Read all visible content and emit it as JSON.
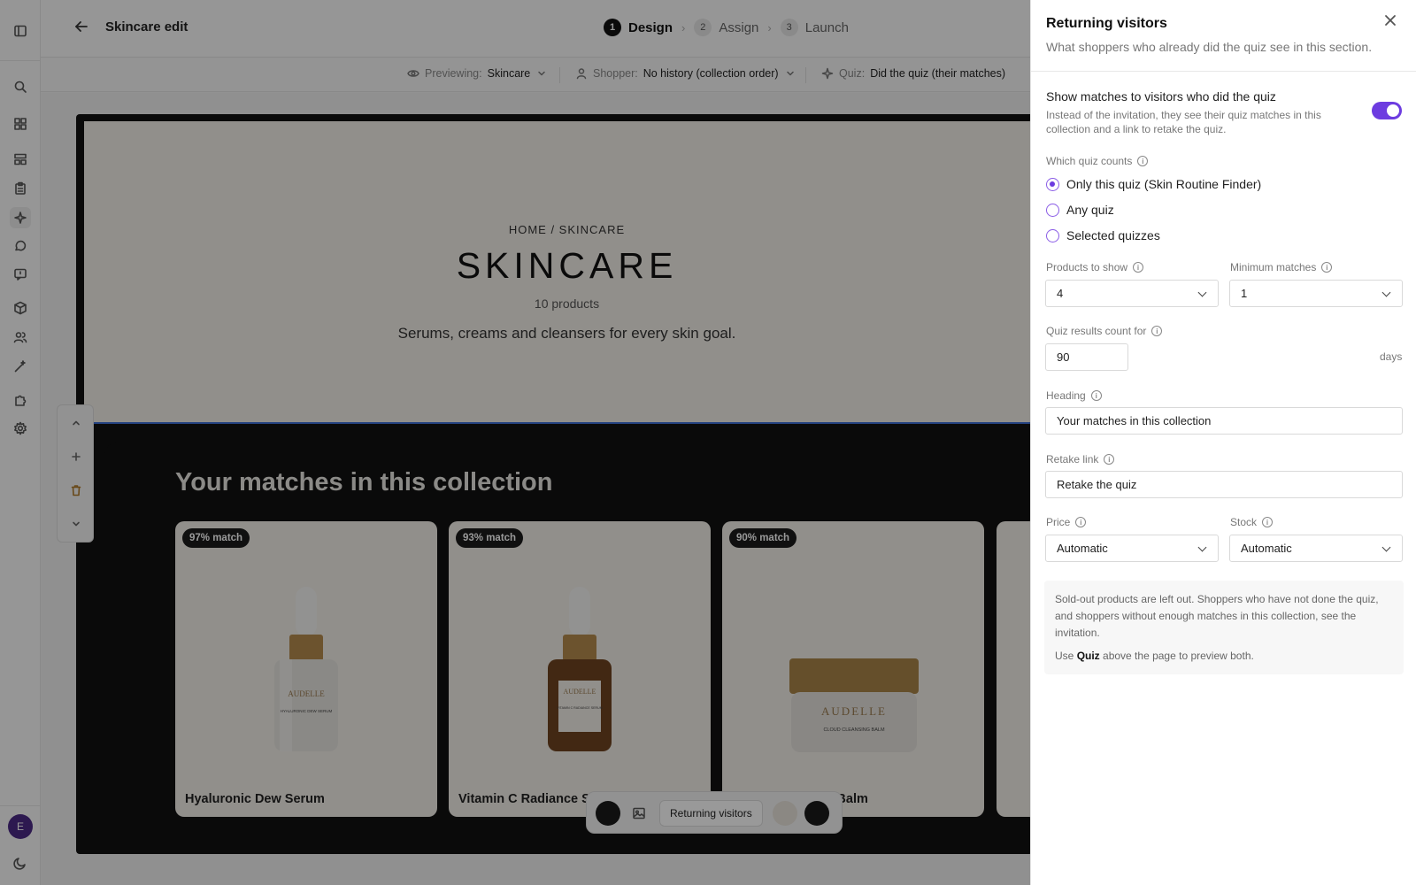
{
  "header": {
    "title": "Skincare edit",
    "steps": [
      {
        "num": "1",
        "label": "Design"
      },
      {
        "num": "2",
        "label": "Assign"
      },
      {
        "num": "3",
        "label": "Launch"
      }
    ]
  },
  "preview_bar": {
    "previewing_label": "Previewing:",
    "previewing_value": "Skincare",
    "shopper_label": "Shopper:",
    "shopper_value": "No history (collection order)",
    "quiz_label": "Quiz:",
    "quiz_value": "Did the quiz (their matches)"
  },
  "hero": {
    "breadcrumb": "HOME  /  SKINCARE",
    "title": "SKINCARE",
    "count": "10 products",
    "description": "Serums, creams and cleansers for every skin goal."
  },
  "matches": {
    "heading": "Your matches in this collection",
    "cards": [
      {
        "badge": "97% match",
        "name": "Hyaluronic Dew Serum",
        "brand": "AUDELLE",
        "label": "HYALURONIC DEW SERUM"
      },
      {
        "badge": "93% match",
        "name": "Vitamin C Radiance Ser",
        "brand": "AUDELLE",
        "label": "VITAMIN C RADIANCE SERUM"
      },
      {
        "badge": "90% match",
        "name": "Cloud Cleansing Balm",
        "brand": "AUDELLE",
        "label": "CLOUD CLEANSING BALM"
      }
    ]
  },
  "bottom_pill": {
    "label": "Returning visitors"
  },
  "panel": {
    "title": "Returning visitors",
    "subtitle": "What shoppers who already did the quiz see in this section.",
    "toggle_title": "Show matches to visitors who did the quiz",
    "toggle_desc": "Instead of the invitation, they see their quiz matches in this collection and a link to retake the quiz.",
    "toggle_on": true,
    "quiz_counts_label": "Which quiz counts",
    "quiz_options": [
      {
        "label": "Only this quiz (Skin Routine Finder)",
        "selected": true
      },
      {
        "label": "Any quiz",
        "selected": false
      },
      {
        "label": "Selected quizzes",
        "selected": false
      }
    ],
    "products_label": "Products to show",
    "products_value": "4",
    "min_matches_label": "Minimum matches",
    "min_matches_value": "1",
    "results_count_label": "Quiz results count for",
    "results_count_value": "90",
    "days_label": "days",
    "heading_label": "Heading",
    "heading_value": "Your matches in this collection",
    "retake_label": "Retake link",
    "retake_value": "Retake the quiz",
    "price_label": "Price",
    "price_value": "Automatic",
    "stock_label": "Stock",
    "stock_value": "Automatic",
    "note_line1": "Sold-out products are left out. Shoppers who have not done the quiz, and shoppers without enough matches in this collection, see the invitation.",
    "note_use": "Use",
    "note_bold": "Quiz",
    "note_rest": "above the page to preview both."
  },
  "user": {
    "initial": "E"
  },
  "colors": {
    "accent": "#6d3ce0",
    "hero_bg": "#f2eee8",
    "dark": "#111111"
  }
}
